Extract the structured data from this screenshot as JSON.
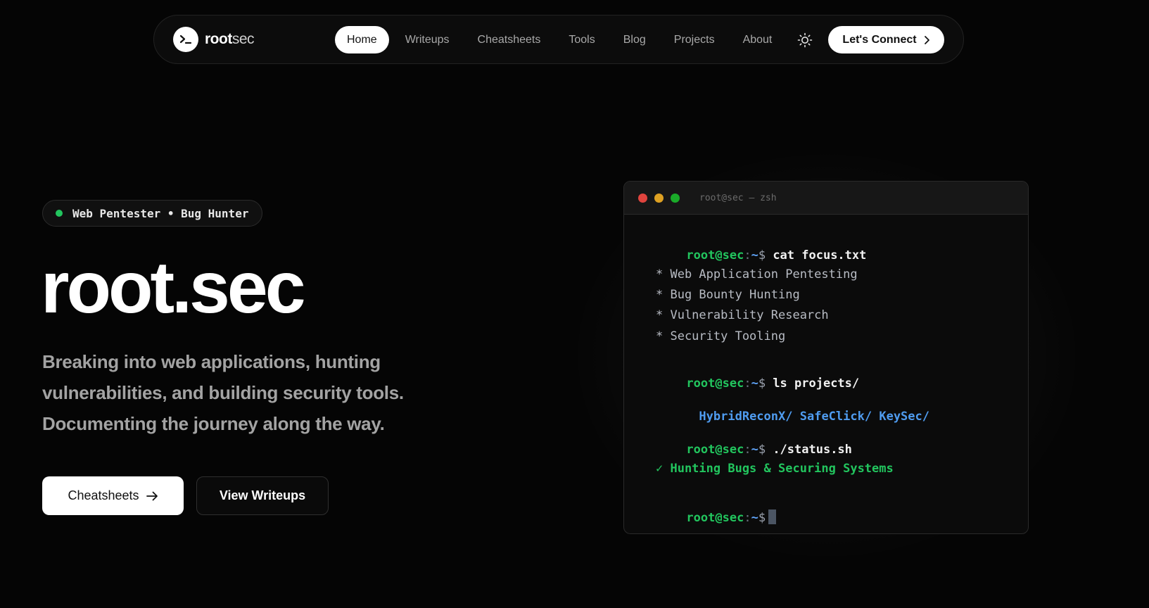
{
  "nav": {
    "logo": {
      "bold": "root",
      "normal": "sec"
    },
    "items": [
      {
        "label": "Home",
        "active": true
      },
      {
        "label": "Writeups",
        "active": false
      },
      {
        "label": "Cheatsheets",
        "active": false
      },
      {
        "label": "Tools",
        "active": false
      },
      {
        "label": "Blog",
        "active": false
      },
      {
        "label": "Projects",
        "active": false
      },
      {
        "label": "About",
        "active": false
      }
    ],
    "theme_icon": "sun-icon",
    "connect_label": "Let's Connect"
  },
  "hero": {
    "badge": "Web Pentester • Bug Hunter",
    "title": "root.sec",
    "description_lines": [
      "Breaking into web applications, hunting",
      "vulnerabilities, and building security tools.",
      "Documenting the journey along the way."
    ],
    "primary_button": "Cheatsheets",
    "secondary_button": "View Writeups"
  },
  "terminal": {
    "title": "root@sec — zsh",
    "prompt": {
      "user": "root@sec",
      "sep": ":",
      "path": "~",
      "dollar": "$"
    },
    "commands": [
      "cat focus.txt",
      "ls projects/",
      "./status.sh"
    ],
    "focus_items": [
      "* Web Application Pentesting",
      "* Bug Bounty Hunting",
      "* Vulnerability Research",
      "* Security Tooling"
    ],
    "projects": [
      "HybridReconX/",
      "SafeClick/",
      "KeySec/"
    ],
    "status": "✓ Hunting Bugs & Securing Systems"
  },
  "colors": {
    "accent_green": "#22c55e",
    "accent_blue": "#60a5fa",
    "background": "#050505"
  }
}
